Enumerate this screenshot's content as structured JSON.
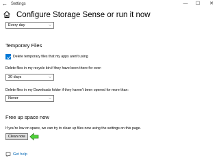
{
  "window": {
    "title": "Settings",
    "back_glyph": "←",
    "minimize_glyph": "—",
    "maximize_glyph": "☐",
    "close_glyph": "✕"
  },
  "header": {
    "title": "Configure Storage Sense or run it now",
    "icon": "home-icon"
  },
  "run_frequency": {
    "value": "Every day"
  },
  "temporary_files": {
    "heading": "Temporary Files",
    "delete_temp_checkbox": {
      "label": "Delete temporary files that my apps aren't using",
      "checked": true
    },
    "recycle_bin": {
      "label": "Delete files in my recycle bin if they have been there for over:",
      "value": "30 days"
    },
    "downloads": {
      "label": "Delete files in my Downloads folder if they haven't been opened for more than:",
      "value": "Never"
    }
  },
  "free_up_space": {
    "heading": "Free up space now",
    "description": "If you're low on space, we can try to clean up files now using the settings on this page.",
    "button_label": "Clean now"
  },
  "help": {
    "label": "Get help",
    "icon": "help-icon"
  },
  "colors": {
    "accent": "#0078d7",
    "link": "#0066b4",
    "arrow_fill": "#4fd23a"
  }
}
